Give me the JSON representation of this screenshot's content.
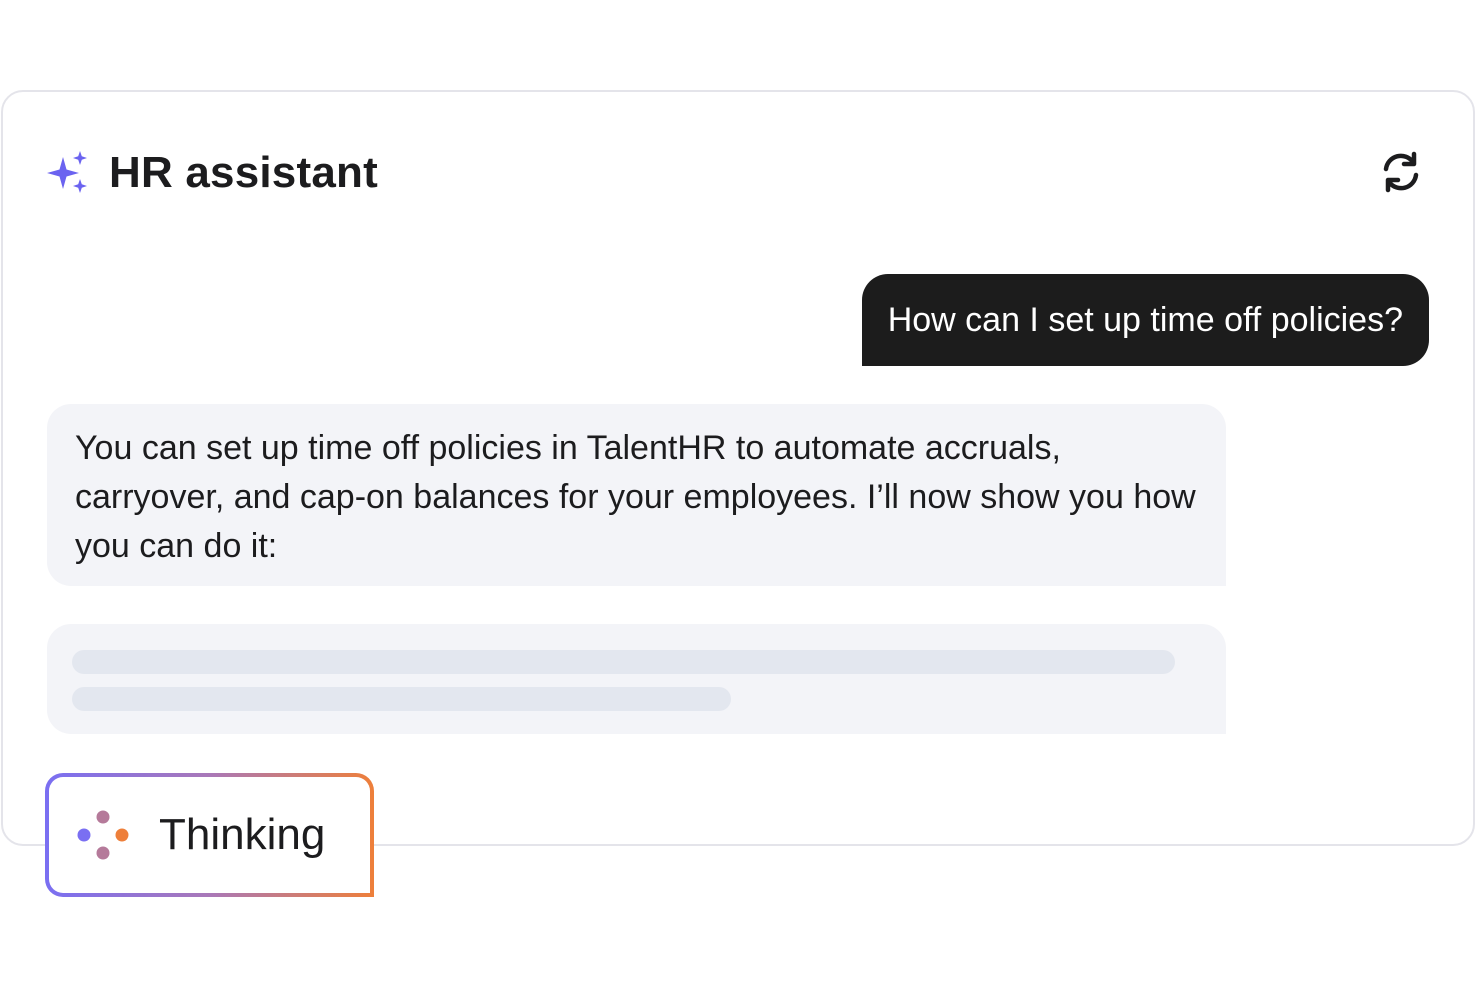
{
  "header": {
    "title": "HR assistant",
    "title_icon": "sparkle-icon",
    "refresh_icon": "refresh-icon"
  },
  "conversation": {
    "user_message": "How can I set up time off policies?",
    "assistant_message": "You can set up time off policies in TalentHR to automate accruals, carryover, and cap-on balances for your employees. I’ll now show you how you can do it:"
  },
  "status": {
    "label": "Thinking",
    "icon": "thinking-dots-icon"
  },
  "colors": {
    "accent": "#6b63f0",
    "user_bubble": "#1c1c1c",
    "assistant_bubble": "#f3f4f8",
    "skeleton": "#e3e7ef",
    "gradient_start": "#7a6ff2",
    "gradient_end": "#ee7f3a"
  }
}
